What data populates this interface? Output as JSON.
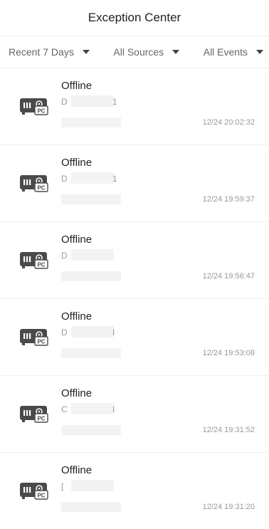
{
  "header": {
    "title": "Exception Center"
  },
  "filters": {
    "range": "Recent 7 Days",
    "source": "All Sources",
    "event": "All Events"
  },
  "events": [
    {
      "title": "Offline",
      "device_prefix": "D",
      "device_suffix": "1",
      "time": "12/24 20:02:32"
    },
    {
      "title": "Offline",
      "device_prefix": "D",
      "device_suffix": "1",
      "time": "12/24 19:59:37"
    },
    {
      "title": "Offline",
      "device_prefix": "D",
      "device_suffix": "",
      "time": "12/24 19:56:47"
    },
    {
      "title": "Offline",
      "device_prefix": "D",
      "device_suffix": "I",
      "time": "12/24 19:53:08"
    },
    {
      "title": "Offline",
      "device_prefix": "C",
      "device_suffix": "I",
      "time": "12/24 19:31:52"
    },
    {
      "title": "Offline",
      "device_prefix": "[",
      "device_suffix": "",
      "time": "12/24 19:31:20"
    }
  ],
  "icons": {
    "device": "pc-nvr-device-icon",
    "dropdown": "caret-down-icon"
  },
  "colors": {
    "icon": "#4a4a4a",
    "text": "#222222",
    "muted": "#999999",
    "divider": "#ededed"
  }
}
